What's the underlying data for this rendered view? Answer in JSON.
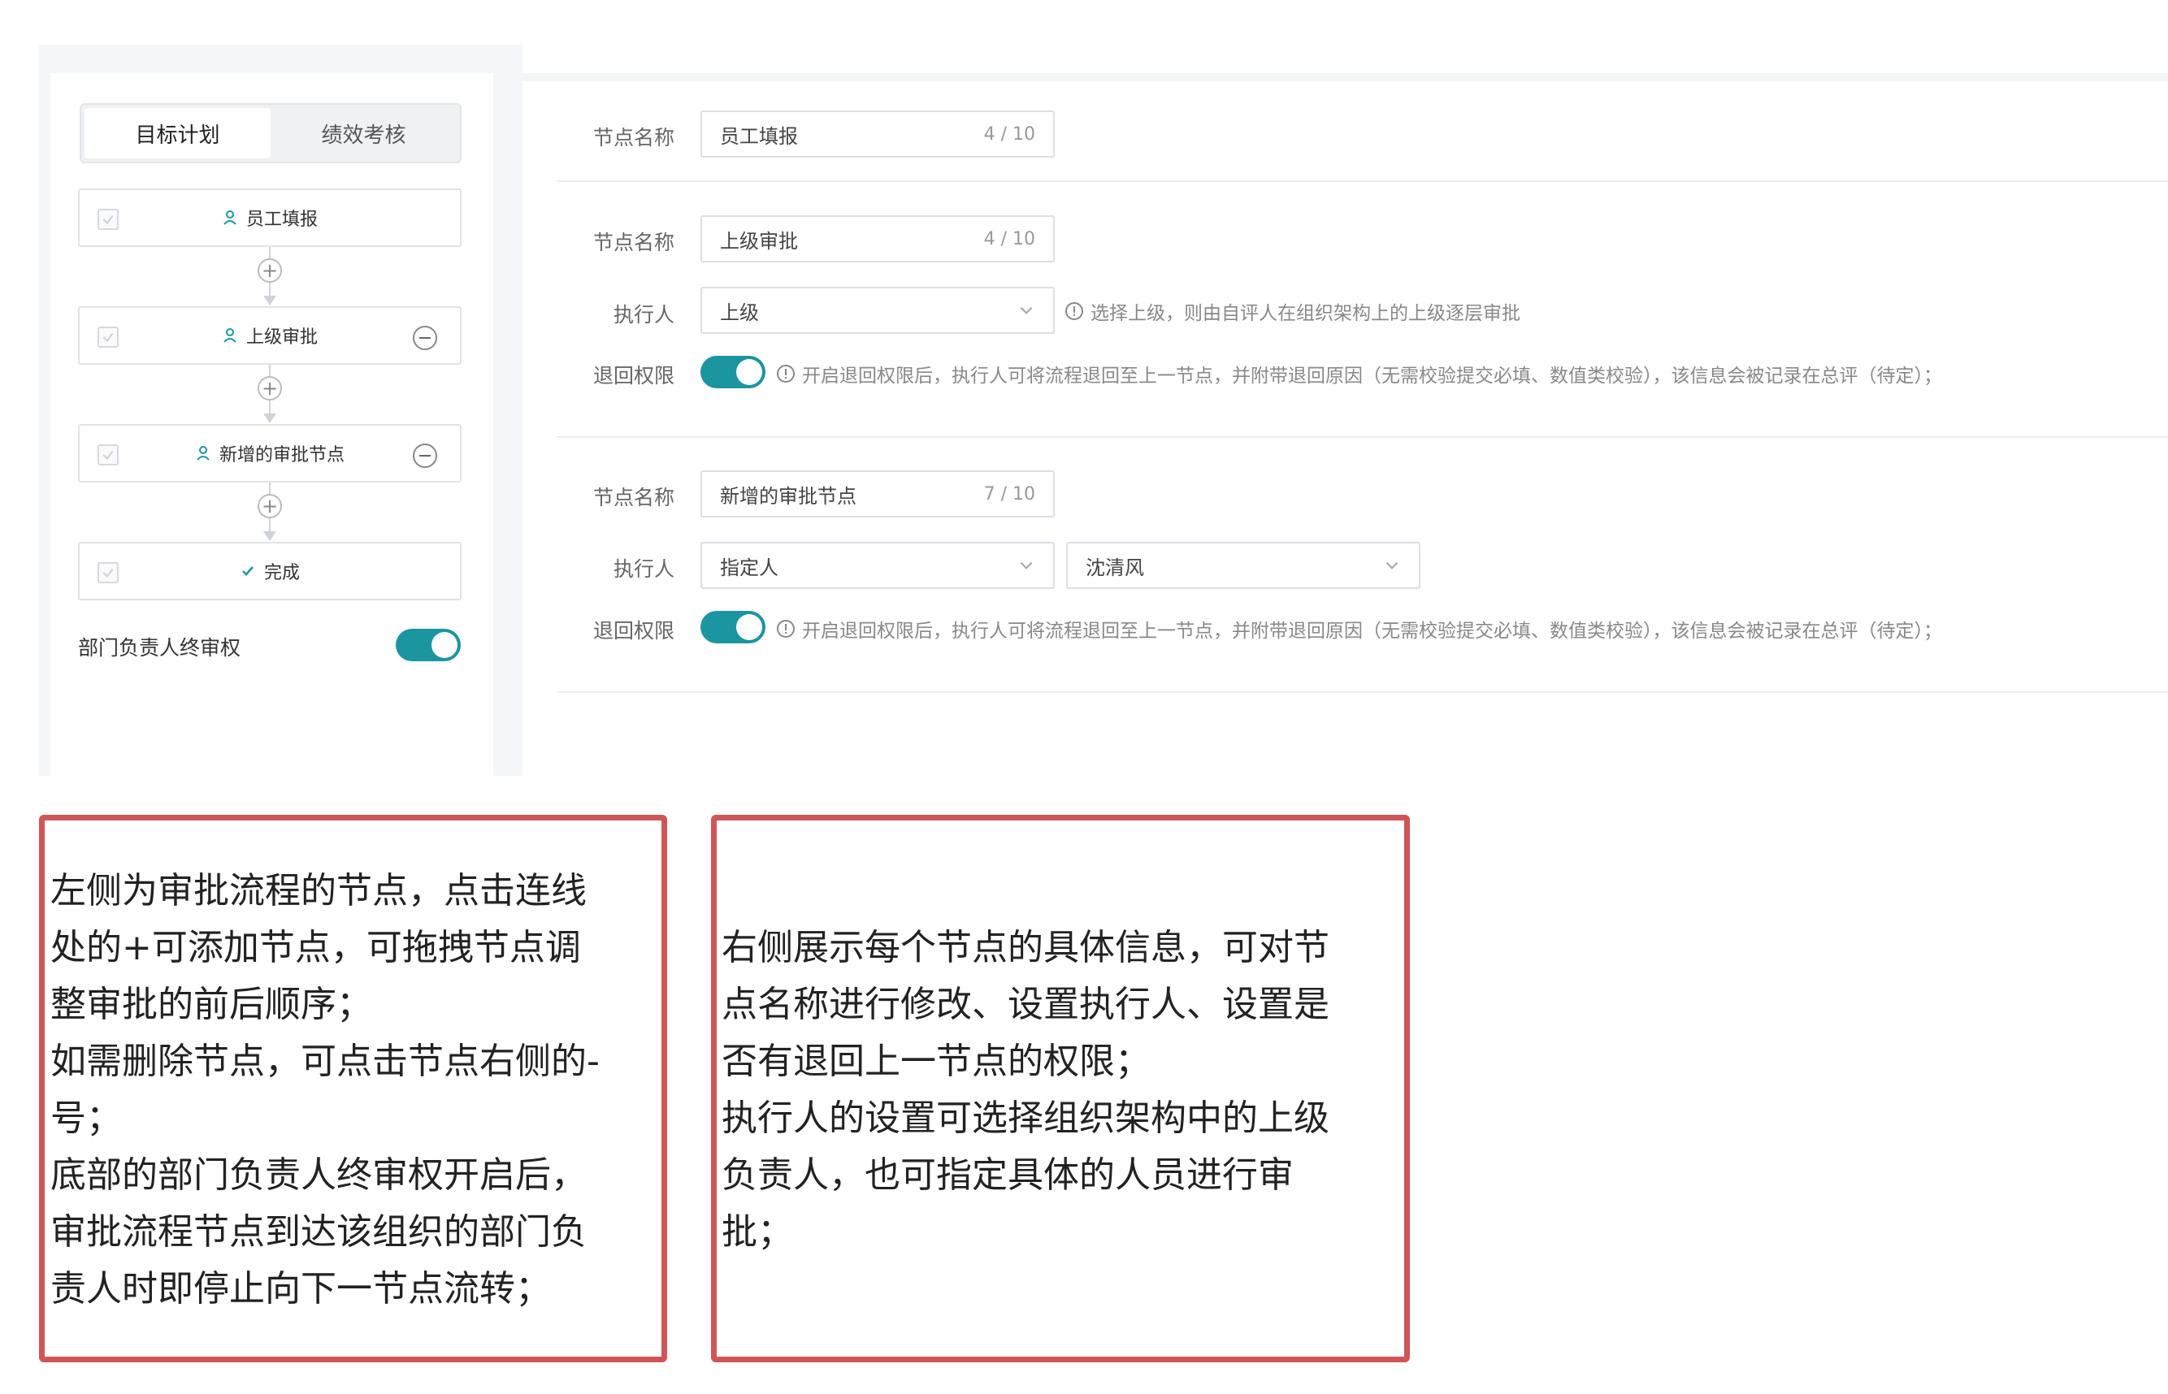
{
  "left_panel": {
    "tabs": [
      {
        "label": "目标计划",
        "active": true
      },
      {
        "label": "绩效考核",
        "active": false
      }
    ],
    "nodes": [
      {
        "label": "员工填报",
        "icon": "user-icon",
        "removable": false
      },
      {
        "label": "上级审批",
        "icon": "user-icon",
        "removable": true
      },
      {
        "label": "新增的审批节点",
        "icon": "user-icon",
        "removable": true
      },
      {
        "label": "完成",
        "icon": "check-icon",
        "removable": false
      }
    ],
    "add_symbol": "+",
    "dept_final_approval": {
      "label": "部门负责人终审权",
      "enabled": true
    }
  },
  "right_panel": {
    "section1": {
      "name_label": "节点名称",
      "name_value": "员工填报",
      "name_count": "4 / 10"
    },
    "section2": {
      "name_label": "节点名称",
      "name_value": "上级审批",
      "name_count": "4 / 10",
      "executor_label": "执行人",
      "executor_value": "上级",
      "executor_hint": "选择上级，则由自评人在组织架构上的上级逐层审批",
      "return_label": "退回权限",
      "return_enabled": true,
      "return_hint": "开启退回权限后，执行人可将流程退回至上一节点，并附带退回原因（无需校验提交必填、数值类校验），该信息会被记录在总评（待定）；"
    },
    "section3": {
      "name_label": "节点名称",
      "name_value": "新增的审批节点",
      "name_count": "7 / 10",
      "executor_label": "执行人",
      "executor_value": "指定人",
      "person_value": "沈清风",
      "return_label": "退回权限",
      "return_enabled": true,
      "return_hint": "开启退回权限后，执行人可将流程退回至上一节点，并附带退回原因（无需校验提交必填、数值类校验），该信息会被记录在总评（待定）；"
    }
  },
  "notes": {
    "left": "左侧为审批流程的节点，点击连线\n处的+可添加节点，可拖拽节点调\n整审批的前后顺序；\n如需删除节点，可点击节点右侧的-\n号；\n底部的部门负责人终审权开启后，\n审批流程节点到达该组织的部门负\n责人时即停止向下一节点流转；",
    "right": "右侧展示每个节点的具体信息，可对节\n点名称进行修改、设置执行人、设置是\n否有退回上一节点的权限；\n执行人的设置可选择组织架构中的上级\n负责人，也可指定具体的人员进行审\n批；"
  },
  "colors": {
    "accent": "#1b95a0",
    "note_border": "#d05556",
    "user_icon": "#1b95a0"
  }
}
